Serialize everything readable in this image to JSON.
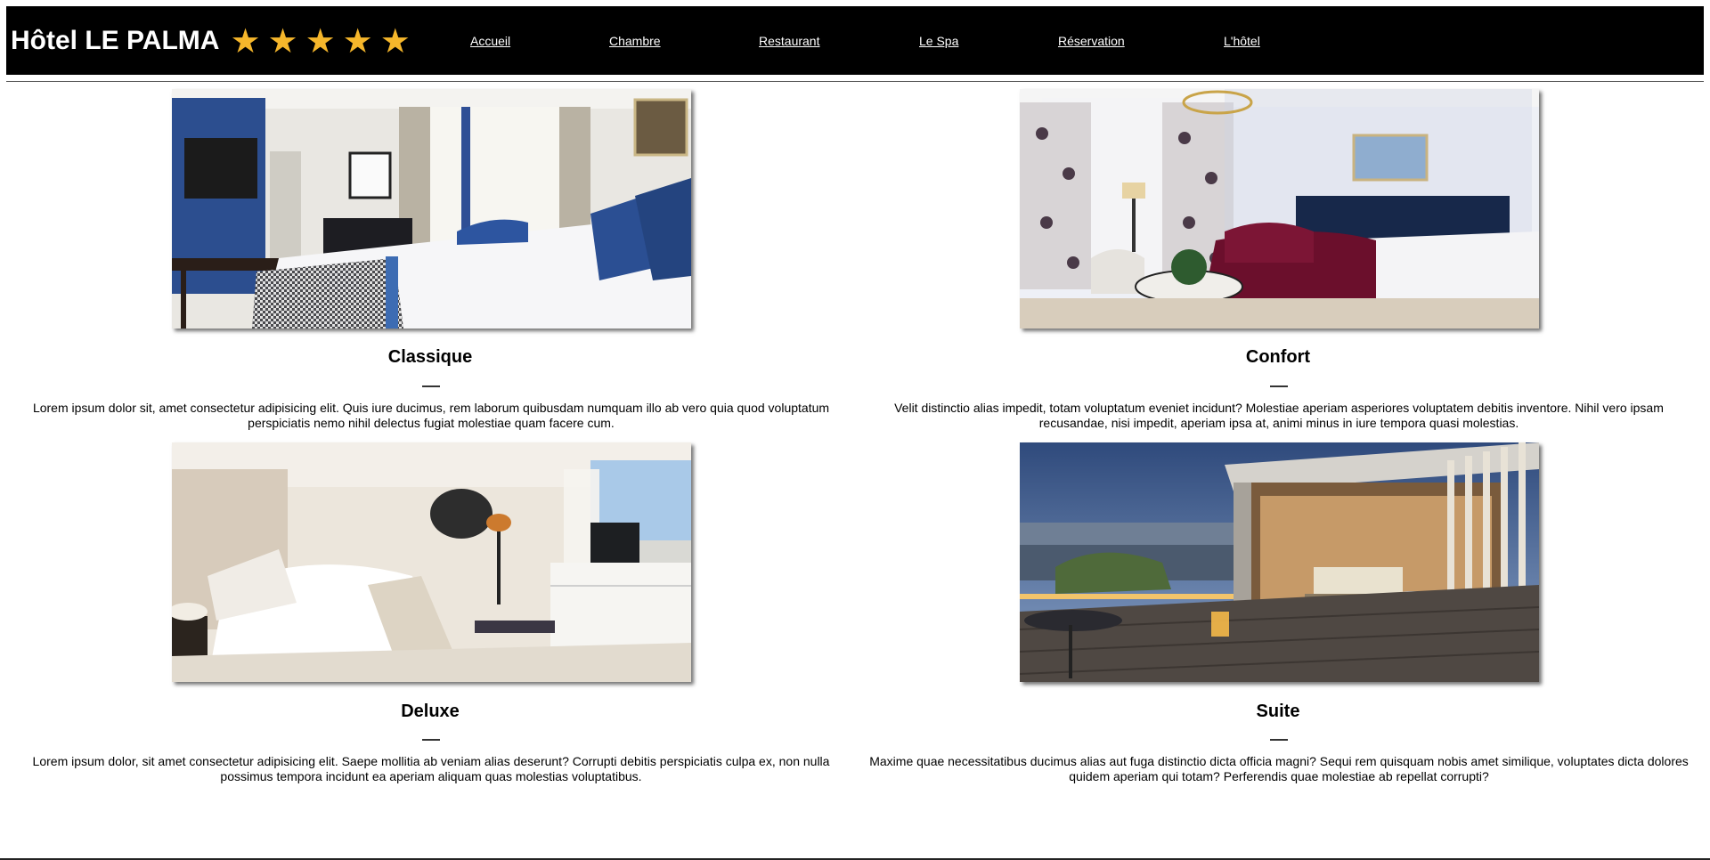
{
  "header": {
    "title": "Hôtel LE PALMA",
    "stars": [
      "★",
      "★",
      "★",
      "★",
      "★"
    ],
    "nav": [
      "Accueil",
      "Chambre",
      "Restaurant",
      "Le Spa",
      "Réservation",
      "L'hôtel"
    ]
  },
  "rooms": [
    {
      "name": "Classique",
      "dash": "—",
      "description": "Lorem ipsum dolor sit, amet consectetur adipisicing elit. Quis iure ducimus, rem laborum quibusdam numquam illo ab vero quia quod voluptatum perspiciatis nemo nihil delectus fugiat molestiae quam facere cum."
    },
    {
      "name": "Confort",
      "dash": "—",
      "description": "Velit distinctio alias impedit, totam voluptatum eveniet incidunt? Molestiae aperiam asperiores voluptatem debitis inventore. Nihil vero ipsam recusandae, nisi impedit, aperiam ipsa at, animi minus in iure tempora quasi molestias."
    },
    {
      "name": "Deluxe",
      "dash": "—",
      "description": "Lorem ipsum dolor, sit amet consectetur adipisicing elit. Saepe mollitia ab veniam alias deserunt? Corrupti debitis perspiciatis culpa ex, non nulla possimus tempora incidunt ea aperiam aliquam quas molestias voluptatibus."
    },
    {
      "name": "Suite",
      "dash": "—",
      "description": "Maxime quae necessitatibus ducimus alias aut fuga distinctio dicta officia magni? Sequi rem quisquam nobis amet similique, voluptates dicta dolores quidem aperiam qui totam? Perferendis quae molestiae ab repellat corrupti?"
    }
  ],
  "colors": {
    "header_bg": "#000000",
    "star": "#f5b62b",
    "nav_text": "#ffffff"
  }
}
